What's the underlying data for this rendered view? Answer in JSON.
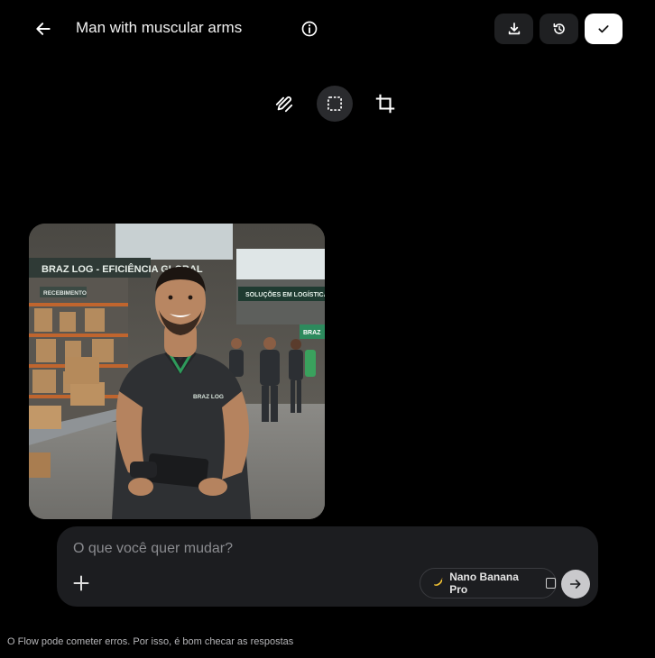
{
  "header": {
    "back_icon": "arrow-left-icon",
    "title": "Man with muscular arms",
    "info_icon": "info-icon",
    "download_icon": "download-icon",
    "history_icon": "history-icon",
    "done_icon": "check-icon"
  },
  "toolbar": {
    "tools": [
      {
        "icon": "edit-pen-icon"
      },
      {
        "icon": "selection-box-icon",
        "active": true
      },
      {
        "icon": "crop-icon"
      }
    ]
  },
  "image": {
    "logo_text": "BRAZ LOG - EFICIÊNCIA GLOBAL",
    "sign_receiving": "RECEBIMENTO",
    "sign_solutions": "SOLUÇÕES EM LOGÍSTICA",
    "sign_small": "BRAZ",
    "shirt_logo": "BRAZ LOG"
  },
  "prompt": {
    "placeholder": "O que você quer mudar?",
    "add_icon": "plus-icon",
    "model_icon": "banana-icon",
    "model_label": "Nano Banana Pro",
    "send_icon": "arrow-right-icon"
  },
  "footer": {
    "disclaimer": "O Flow pode cometer erros. Por isso, é bom checar as respostas"
  },
  "colors": {
    "background": "#000000",
    "panel": "#1c1d20",
    "button_dark": "#1f2022",
    "button_light": "#ffffff",
    "brand_green": "#2e9b5b"
  }
}
